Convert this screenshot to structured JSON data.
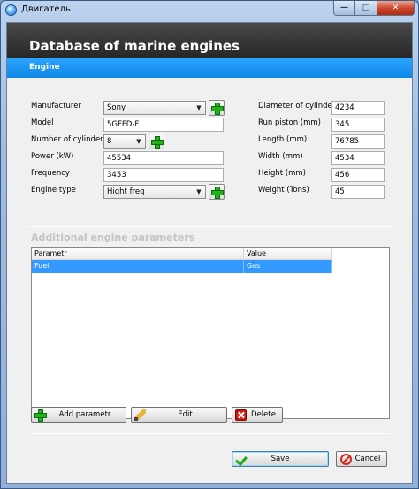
{
  "window": {
    "title": "Двигатель"
  },
  "header": {
    "title": "Database of marine engines",
    "subtitle": "Engine"
  },
  "form": {
    "manufacturer": {
      "label": "Manufacturer",
      "value": "Sony"
    },
    "model": {
      "label": "Model",
      "value": "5GFFD-F"
    },
    "cylinders": {
      "label": "Number of cylinders",
      "value": "8"
    },
    "power": {
      "label": "Power (kW)",
      "value": "45534"
    },
    "frequency": {
      "label": "Frequency",
      "value": "3453"
    },
    "engine_type": {
      "label": "Engine type",
      "value": "Hight freq"
    },
    "diameter": {
      "label": "Diameter of cylinder",
      "value": "4234"
    },
    "run_piston": {
      "label": "Run piston (mm)",
      "value": "345"
    },
    "length": {
      "label": "Length (mm)",
      "value": "76785"
    },
    "width": {
      "label": "Width (mm)",
      "value": "4534"
    },
    "height": {
      "label": "Height (mm)",
      "value": "456"
    },
    "weight": {
      "label": "Weight (Tons)",
      "value": "45"
    }
  },
  "params": {
    "title": "Additional engine parameters",
    "columns": [
      "Parametr",
      "Value"
    ],
    "rows": [
      {
        "param": "Fuel",
        "value": "Gas"
      }
    ]
  },
  "toolbar": {
    "add_label": "Add parametr",
    "edit_label": "Edit",
    "delete_label": "Delete"
  },
  "dialog": {
    "save_label": "Save",
    "cancel_label": "Cancel"
  }
}
